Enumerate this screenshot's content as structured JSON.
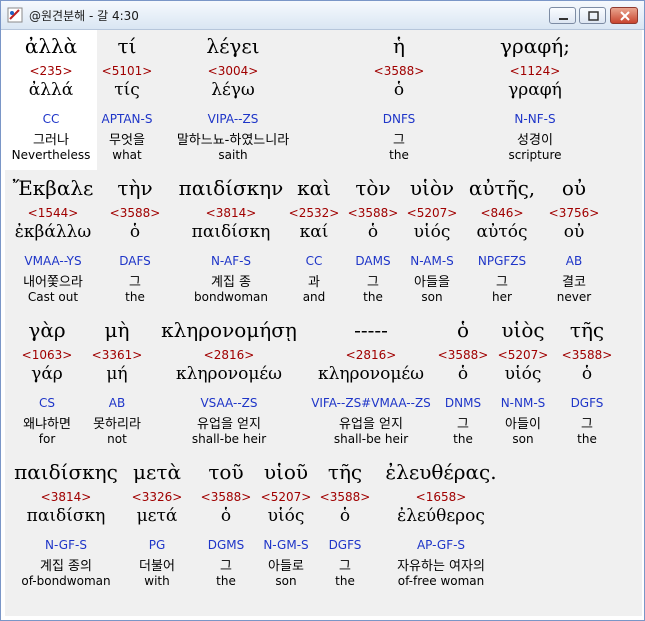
{
  "window": {
    "title": "@원견분해 - 갈 4:30",
    "accent_close": "#c9452f"
  },
  "blocks": [
    {
      "words": [
        {
          "surface": "ἀλλὰ",
          "code": "<235>",
          "lemma": "ἀλλά",
          "morph": "CC",
          "kor": "그러나",
          "eng": "Nevertheless"
        },
        {
          "surface": "τί",
          "code": "<5101>",
          "lemma": "τίς",
          "morph": "APTAN-S",
          "kor": "무엇을",
          "eng": "what"
        },
        {
          "surface": "λέγει",
          "code": "<3004>",
          "lemma": "λέγω",
          "morph": "VIPA--ZS",
          "kor": "말하느뇨-하였느니라",
          "eng": "saith"
        },
        {
          "surface": "ἡ",
          "code": "<3588>",
          "lemma": "ὁ",
          "morph": "DNFS",
          "kor": "그",
          "eng": "the"
        },
        {
          "surface": "γραφή;",
          "code": "<1124>",
          "lemma": "γραφή",
          "morph": "N-NF-S",
          "kor": "성경이",
          "eng": "scripture"
        }
      ]
    },
    {
      "words": [
        {
          "surface": "Ἔκβαλε",
          "code": "<1544>",
          "lemma": "ἐκβάλλω",
          "morph": "VMAA--YS",
          "kor": "내어쫓으라",
          "eng": "Cast out"
        },
        {
          "surface": "τὴν",
          "code": "<3588>",
          "lemma": "ὁ",
          "morph": "DAFS",
          "kor": "그",
          "eng": "the"
        },
        {
          "surface": "παιδίσκην",
          "code": "<3814>",
          "lemma": "παιδίσκη",
          "morph": "N-AF-S",
          "kor": "계집 종",
          "eng": "bondwoman"
        },
        {
          "surface": "καὶ",
          "code": "<2532>",
          "lemma": "καί",
          "morph": "CC",
          "kor": "과",
          "eng": "and"
        },
        {
          "surface": "τὸν",
          "code": "<3588>",
          "lemma": "ὁ",
          "morph": "DAMS",
          "kor": "그",
          "eng": "the"
        },
        {
          "surface": "υἱὸν",
          "code": "<5207>",
          "lemma": "υἱός",
          "morph": "N-AM-S",
          "kor": "아들을",
          "eng": "son"
        },
        {
          "surface": "αὐτῆς,",
          "code": "<846>",
          "lemma": "αὐτός",
          "morph": "NPGFZS",
          "kor": "그",
          "eng": "her"
        },
        {
          "surface": "οὐ",
          "code": "<3756>",
          "lemma": "οὐ",
          "morph": "AB",
          "kor": "결코",
          "eng": "never"
        }
      ]
    },
    {
      "words": [
        {
          "surface": "γὰρ",
          "code": "<1063>",
          "lemma": "γάρ",
          "morph": "CS",
          "kor": "왜냐하면",
          "eng": "for"
        },
        {
          "surface": "μὴ",
          "code": "<3361>",
          "lemma": "μή",
          "morph": "AB",
          "kor": "못하리라",
          "eng": "not"
        },
        {
          "surface": "κληρονομήσῃ",
          "code": "<2816>",
          "lemma": "κληρονομέω",
          "morph": "VSAA--ZS",
          "kor": "유업을 얻지",
          "eng": "shall-be heir"
        },
        {
          "surface": "-----",
          "code": "<2816>",
          "lemma": "κληρονομέω",
          "morph": "VIFA--ZS#VMAA--ZS",
          "kor": "유업을 얻지",
          "eng": "shall-be heir"
        },
        {
          "surface": "ὁ",
          "code": "<3588>",
          "lemma": "ὁ",
          "morph": "DNMS",
          "kor": "그",
          "eng": "the"
        },
        {
          "surface": "υἱὸς",
          "code": "<5207>",
          "lemma": "υἱός",
          "morph": "N-NM-S",
          "kor": "아들이",
          "eng": "son"
        },
        {
          "surface": "τῆς",
          "code": "<3588>",
          "lemma": "ὁ",
          "morph": "DGFS",
          "kor": "그",
          "eng": "the"
        }
      ]
    },
    {
      "words": [
        {
          "surface": "παιδίσκης",
          "code": "<3814>",
          "lemma": "παιδίσκη",
          "morph": "N-GF-S",
          "kor": "계집 종의",
          "eng": "of-bondwoman"
        },
        {
          "surface": "μετὰ",
          "code": "<3326>",
          "lemma": "μετά",
          "morph": "PG",
          "kor": "더불어",
          "eng": "with"
        },
        {
          "surface": "τοῦ",
          "code": "<3588>",
          "lemma": "ὁ",
          "morph": "DGMS",
          "kor": "그",
          "eng": "the"
        },
        {
          "surface": "υἱοῦ",
          "code": "<5207>",
          "lemma": "υἱός",
          "morph": "N-GM-S",
          "kor": "아들로",
          "eng": "son"
        },
        {
          "surface": "τῆς",
          "code": "<3588>",
          "lemma": "ὁ",
          "morph": "DGFS",
          "kor": "그",
          "eng": "the"
        },
        {
          "surface": "ἐλευθέρας.",
          "code": "<1658>",
          "lemma": "ἐλεύθερος",
          "morph": "AP-GF-S",
          "kor": "자유하는 여자의",
          "eng": "of-free woman"
        }
      ]
    }
  ]
}
